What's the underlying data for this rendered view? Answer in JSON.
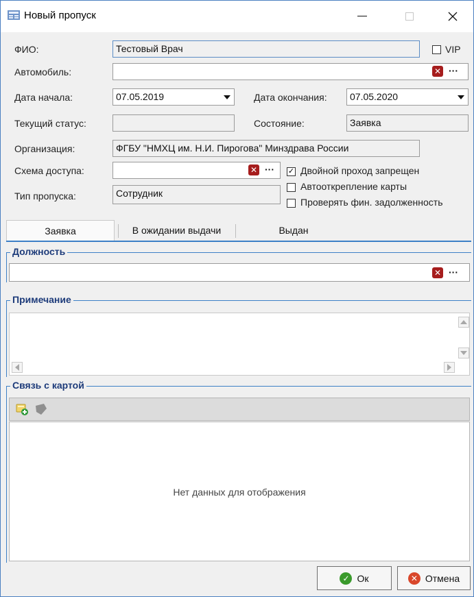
{
  "window": {
    "title": "Новый пропуск"
  },
  "form": {
    "fio_label": "ФИО:",
    "fio_value": "Тестовый Врач",
    "vip_label": "VIP",
    "auto_label": "Автомобиль:",
    "auto_value": "",
    "start_label": "Дата начала:",
    "start_value": "07.05.2019",
    "end_label": "Дата окончания:",
    "end_value": "07.05.2020",
    "status_label": "Текущий статус:",
    "status_value": "",
    "state_label": "Состояние:",
    "state_value": "Заявка",
    "org_label": "Организация:",
    "org_value": "ФГБУ \"НМХЦ им. Н.И. Пирогова\" Минздрава России",
    "scheme_label": "Схема доступа:",
    "scheme_value": "",
    "type_label": "Тип пропуска:",
    "type_value": "Сотрудник"
  },
  "checkboxes": [
    {
      "label": "Двойной проход запрещен",
      "checked": true
    },
    {
      "label": "Автооткрепление карты",
      "checked": false
    },
    {
      "label": "Проверять фин. задолженность",
      "checked": false
    }
  ],
  "vip_checked": false,
  "tabs": [
    {
      "label": "Заявка",
      "active": true
    },
    {
      "label": "В ожидании выдачи",
      "active": false
    },
    {
      "label": "Выдан",
      "active": false
    }
  ],
  "sections": {
    "position_title": "Должность",
    "position_value": "",
    "note_title": "Примечание",
    "card_title": "Связь с картой"
  },
  "grid": {
    "empty_message": "Нет данных для отображения"
  },
  "buttons": {
    "ok": "Ок",
    "cancel": "Отмена"
  },
  "icons": {
    "title": "form-icon",
    "clear": "clear-x-icon",
    "more": "ellipsis-icon",
    "add_card": "add-card-icon",
    "remove_card": "remove-card-icon",
    "ok": "ok-check-icon",
    "cancel": "cancel-x-icon"
  },
  "colors": {
    "accent": "#3c7fc6",
    "section_title": "#1d3b7a",
    "clear_red": "#a61d1d",
    "ok_green": "#3a9a2c",
    "cancel_red": "#d9472b"
  }
}
